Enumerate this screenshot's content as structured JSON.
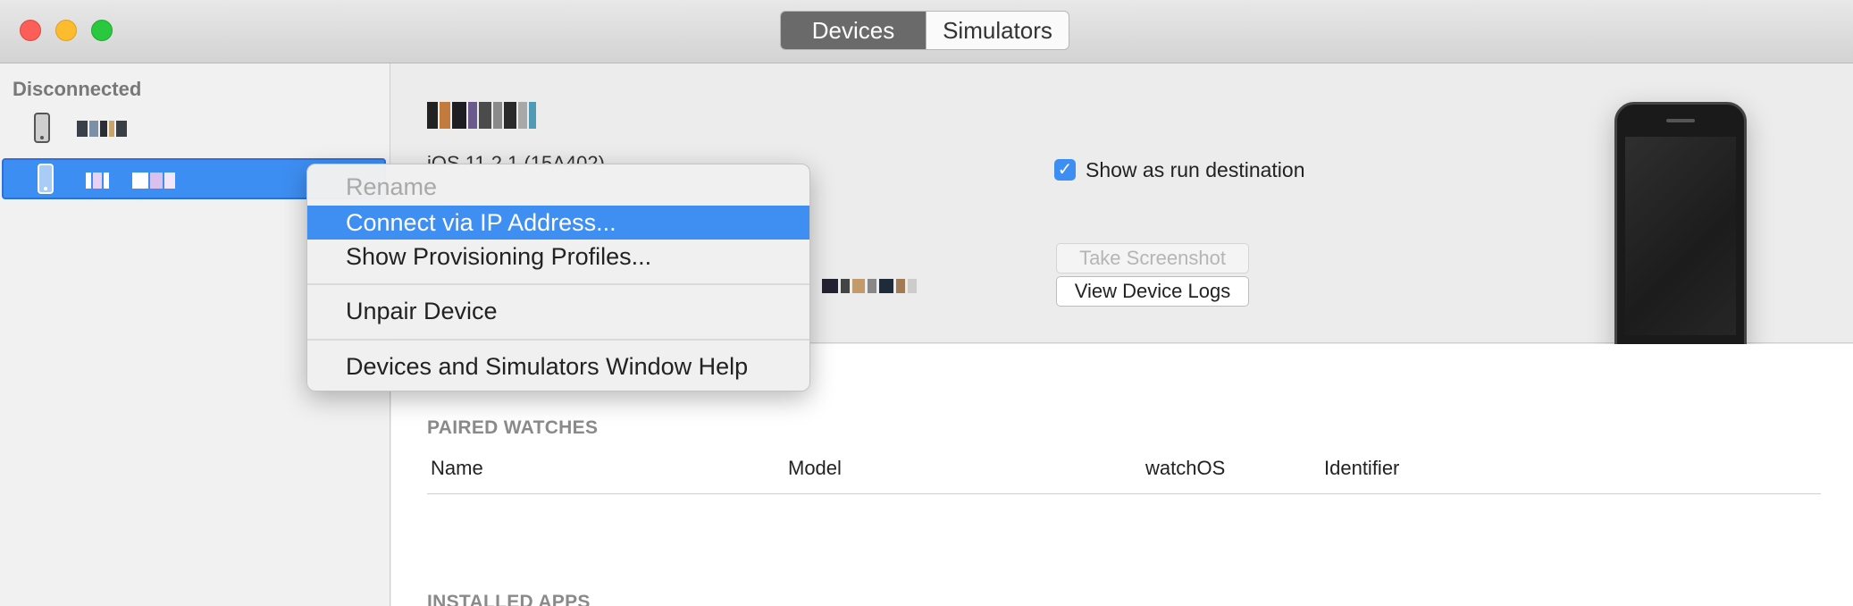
{
  "window": {
    "tabs": [
      {
        "label": "Devices",
        "selected": true
      },
      {
        "label": "Simulators",
        "selected": false
      }
    ]
  },
  "sidebar": {
    "section_label": "Disconnected",
    "devices": [
      {
        "icon": "iphone-icon",
        "selected": false
      },
      {
        "icon": "iphone-icon",
        "selected": true
      }
    ]
  },
  "device_detail": {
    "os_version_partial": "iOS 11.2.1 (15A402)",
    "show_run_destination_label": "Show as run destination",
    "show_run_destination_checked": true,
    "take_screenshot_label": "Take Screenshot",
    "view_logs_label": "View Device Logs"
  },
  "paired_watches": {
    "title": "PAIRED WATCHES",
    "columns": [
      "Name",
      "Model",
      "watchOS",
      "Identifier"
    ]
  },
  "installed_apps": {
    "title": "INSTALLED APPS"
  },
  "context_menu": {
    "items": [
      {
        "label": "Rename",
        "disabled": true
      },
      {
        "label": "Connect via IP Address...",
        "highlighted": true
      },
      {
        "label": "Show Provisioning Profiles..."
      },
      {
        "label": "Unpair Device"
      },
      {
        "label": "Devices and Simulators Window Help"
      }
    ]
  },
  "colors": {
    "accent": "#3f8ff3",
    "selected_segment": "#6a6a6a"
  }
}
